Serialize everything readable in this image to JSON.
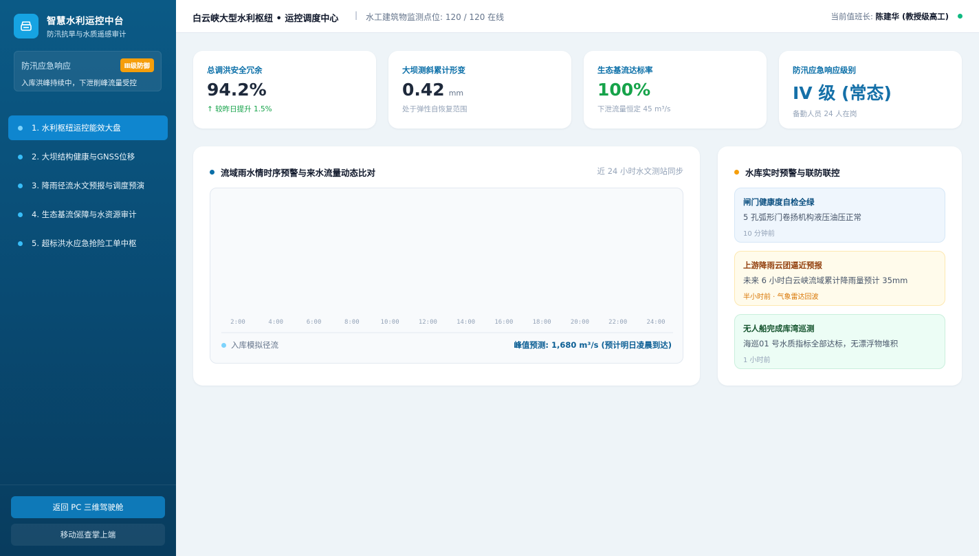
{
  "brand": {
    "title": "智慧水利运控中台",
    "subtitle": "防汛抗旱与水质遥感审计",
    "logo_icon": "reservoir-icon"
  },
  "emergency": {
    "title": "防汛应急响应",
    "badge": "Ⅲ级防御",
    "description": "入库洪峰持续中，下泄削峰流量受控"
  },
  "nav": {
    "items": [
      {
        "label": "1. 水利枢纽运控能效大盘",
        "active": true
      },
      {
        "label": "2. 大坝结构健康与GNSS位移",
        "active": false
      },
      {
        "label": "3. 降雨径流水文预报与调度预演",
        "active": false
      },
      {
        "label": "4. 生态基流保障与水资源审计",
        "active": false
      },
      {
        "label": "5. 超标洪水应急抢险工单中枢",
        "active": false
      }
    ]
  },
  "sidebar_buttons": {
    "primary": "返回 PC 三维驾驶舱",
    "secondary": "移动巡查掌上端"
  },
  "header": {
    "title": "白云峡大型水利枢纽 • 运控调度中心",
    "separator": "|",
    "status": "水工建筑物监测点位: 120 / 120 在线",
    "duty_label": "当前值班长: ",
    "duty_name": "陈建华 (教授级高工)",
    "online_color": "#10b981"
  },
  "kpis": [
    {
      "label": "总调洪安全冗余",
      "value": "94.2%",
      "unit": "",
      "note": "↑ 较昨日提升 1.5%"
    },
    {
      "label": "大坝测斜累计形变",
      "value": "0.42",
      "unit": "mm",
      "note": "处于弹性自恢复范围"
    },
    {
      "label": "生态基流达标率",
      "value": "100%",
      "unit": "",
      "note": "下泄流量恒定 45 m³/s"
    },
    {
      "label": "防汛应急响应级别",
      "value": "IV 级 (常态)",
      "unit": "",
      "note": "备勤人员 24 人在岗"
    }
  ],
  "chart_panel": {
    "title": "流域雨水情时序预警与来水流量动态比对",
    "hint": "近 24 小时水文测站同步",
    "legend": "入库模拟径流",
    "peak": "峰值预测: 1,680 m³/s (预计明日凌晨到达)"
  },
  "chart_data": {
    "type": "line",
    "x": [
      "2:00",
      "4:00",
      "6:00",
      "8:00",
      "10:00",
      "12:00",
      "14:00",
      "16:00",
      "18:00",
      "20:00",
      "22:00",
      "24:00"
    ],
    "series": [
      {
        "name": "入库模拟径流",
        "values": [],
        "color": "#7dd3fc"
      }
    ],
    "title": "流域雨水情时序预警与来水流量动态比对",
    "xlabel": "",
    "ylabel": ""
  },
  "alerts_panel": {
    "title": "水库实时预警与联防联控",
    "items": [
      {
        "title": "闸门健康度自检全绿",
        "desc": "5 孔弧形门卷扬机构液压油压正常",
        "meta": "10 分钟前"
      },
      {
        "title": "上游降雨云团逼近预报",
        "desc": "未来 6 小时白云峡流域累计降雨量预计 35mm",
        "meta": "半小时前 · 气象雷达回波"
      },
      {
        "title": "无人船完成库湾巡测",
        "desc": "海巡01 号水质指标全部达标，无漂浮物堆积",
        "meta": "1 小时前"
      }
    ]
  },
  "colors": {
    "accent": "#0f86cf",
    "warning": "#f59e0b",
    "success": "#16a34a"
  }
}
